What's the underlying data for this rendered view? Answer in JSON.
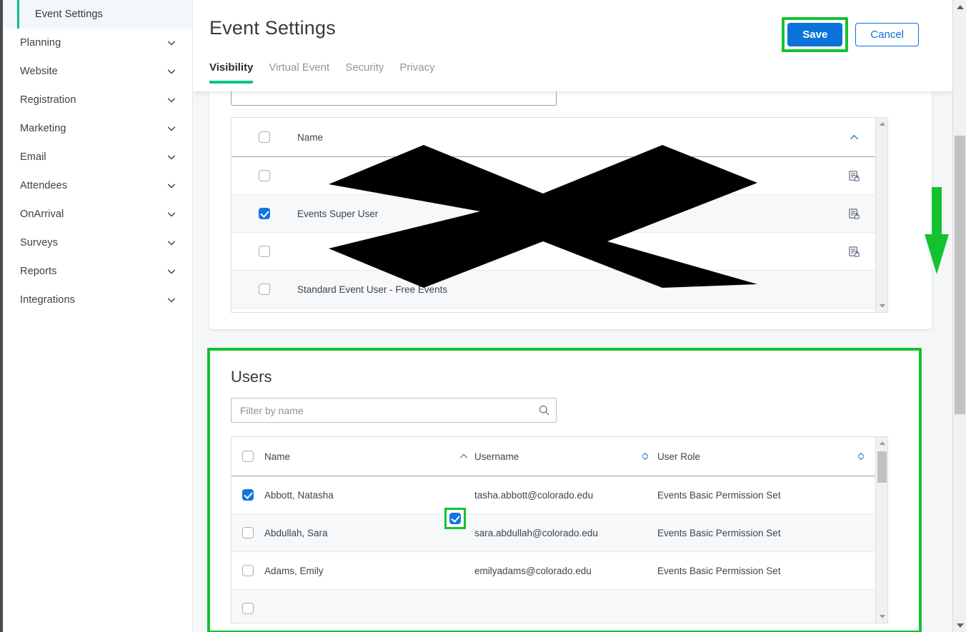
{
  "sidebar": {
    "items": [
      {
        "label": "Event Settings",
        "active": true,
        "has_chevron": false
      },
      {
        "label": "Planning",
        "active": false,
        "has_chevron": true
      },
      {
        "label": "Website",
        "active": false,
        "has_chevron": true
      },
      {
        "label": "Registration",
        "active": false,
        "has_chevron": true
      },
      {
        "label": "Marketing",
        "active": false,
        "has_chevron": true
      },
      {
        "label": "Email",
        "active": false,
        "has_chevron": true
      },
      {
        "label": "Attendees",
        "active": false,
        "has_chevron": true
      },
      {
        "label": "OnArrival",
        "active": false,
        "has_chevron": true
      },
      {
        "label": "Surveys",
        "active": false,
        "has_chevron": true
      },
      {
        "label": "Reports",
        "active": false,
        "has_chevron": true
      },
      {
        "label": "Integrations",
        "active": false,
        "has_chevron": true
      }
    ]
  },
  "header": {
    "title": "Event Settings",
    "save_label": "Save",
    "cancel_label": "Cancel",
    "tabs": [
      {
        "label": "Visibility",
        "active": true
      },
      {
        "label": "Virtual Event",
        "active": false
      },
      {
        "label": "Security",
        "active": false
      },
      {
        "label": "Privacy",
        "active": false
      }
    ]
  },
  "roles_table": {
    "columns": [
      "",
      "Name",
      ""
    ],
    "header_name": "Name",
    "header_sort_icon": "chevron-up-icon",
    "rows": [
      {
        "checked": false,
        "name": "",
        "end_icon": "locked-list-icon",
        "alt": false
      },
      {
        "checked": true,
        "name": "Events Super User",
        "end_icon": "locked-list-icon",
        "alt": true
      },
      {
        "checked": false,
        "name": "",
        "end_icon": "locked-list-icon",
        "alt": false
      },
      {
        "checked": false,
        "name": "Standard Event User - Free Events",
        "end_icon": "",
        "alt": true
      }
    ]
  },
  "users": {
    "title": "Users",
    "filter_placeholder": "Filter by name",
    "filter_value": "",
    "search_icon": "search-icon",
    "columns": [
      {
        "label": "Name",
        "sort_icon": "chevron-up-icon"
      },
      {
        "label": "Username",
        "sort_icon": "sort-both-icon"
      },
      {
        "label": "User Role",
        "sort_icon": "sort-both-icon"
      }
    ],
    "rows": [
      {
        "checked": true,
        "highlighted": true,
        "name": "Abbott, Natasha",
        "username": "tasha.abbott@colorado.edu",
        "role": "Events Basic Permission Set",
        "alt": false
      },
      {
        "checked": false,
        "highlighted": false,
        "name": "Abdullah, Sara",
        "username": "sara.abdullah@colorado.edu",
        "role": "Events Basic Permission Set",
        "alt": true
      },
      {
        "checked": false,
        "highlighted": false,
        "name": "Adams, Emily",
        "username": "emilyadams@colorado.edu",
        "role": "Events Basic Permission Set",
        "alt": false
      },
      {
        "checked": false,
        "highlighted": false,
        "name": "",
        "username": "",
        "role": "",
        "alt": true
      }
    ]
  },
  "annotations": {
    "highlight_color": "#14c230",
    "arrow": "green-down-arrow",
    "redaction": "black-x-mark"
  },
  "colors": {
    "accent_teal": "#00c389",
    "primary_blue": "#0a72d9",
    "checkbox_blue": "#1474e0",
    "annotation_green": "#14c230",
    "page_bg": "#f4f6f7"
  }
}
